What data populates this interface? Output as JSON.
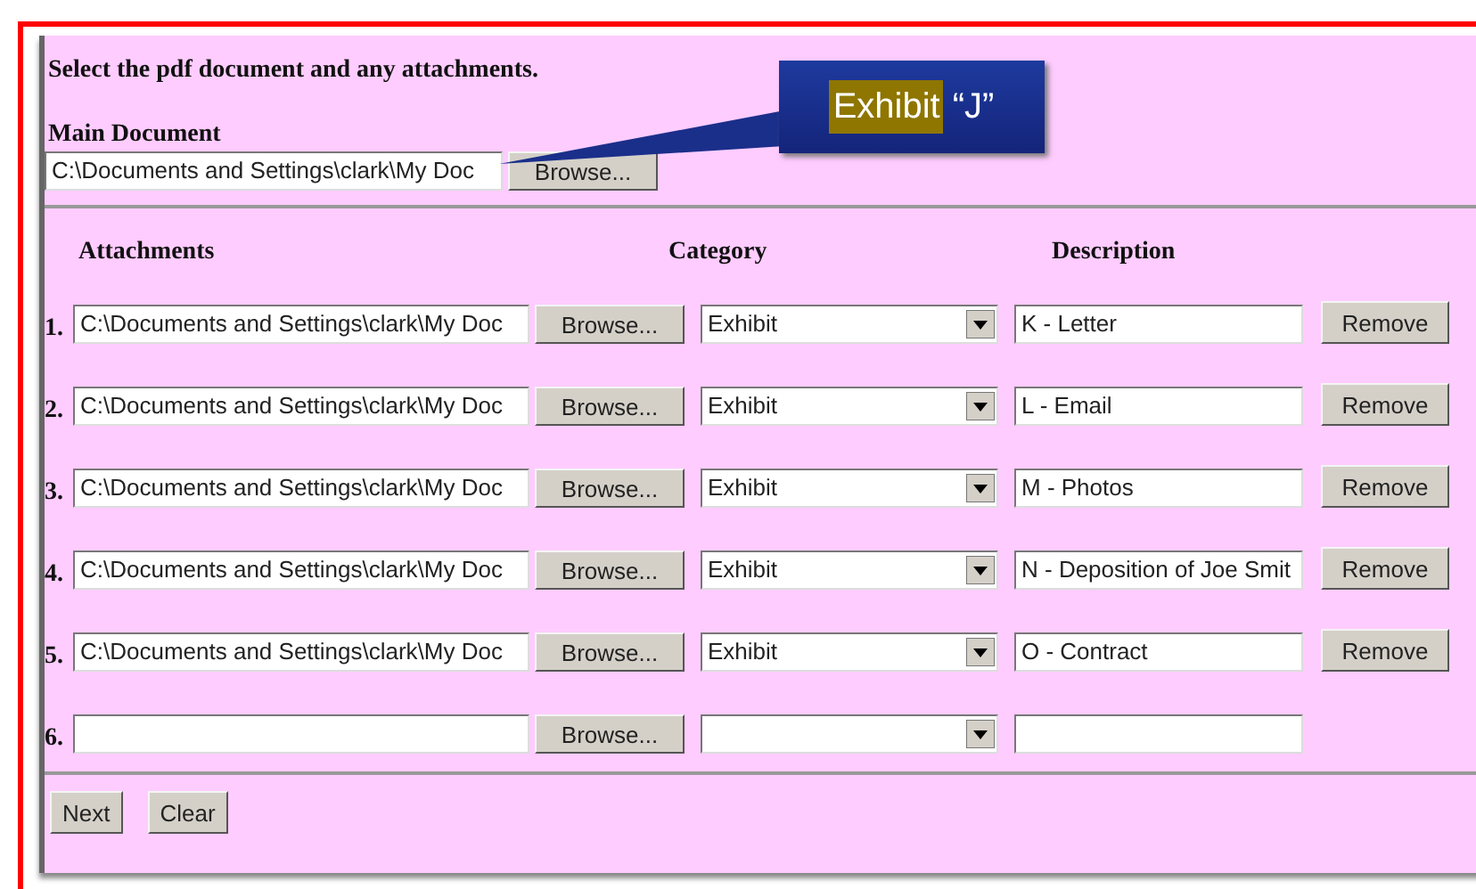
{
  "instruction": "Select the pdf document and any attachments.",
  "main_document": {
    "label": "Main Document",
    "value": "C:\\Documents and Settings\\clark\\My Doc",
    "browse": "Browse..."
  },
  "callout": {
    "highlight": "Exhibit",
    "text": "“J”"
  },
  "columns": [
    "Attachments",
    "Category",
    "Description"
  ],
  "rows": [
    {
      "number": "1.",
      "file": "C:\\Documents and Settings\\clark\\My Doc",
      "browse": "Browse...",
      "category": "Exhibit",
      "description": "K - Letter",
      "remove": "Remove"
    },
    {
      "number": "2.",
      "file": "C:\\Documents and Settings\\clark\\My Doc",
      "browse": "Browse...",
      "category": "Exhibit",
      "description": "L - Email",
      "remove": "Remove"
    },
    {
      "number": "3.",
      "file": "C:\\Documents and Settings\\clark\\My Doc",
      "browse": "Browse...",
      "category": "Exhibit",
      "description": "M - Photos",
      "remove": "Remove"
    },
    {
      "number": "4.",
      "file": "C:\\Documents and Settings\\clark\\My Doc",
      "browse": "Browse...",
      "category": "Exhibit",
      "description": "N - Deposition of Joe Smit",
      "remove": "Remove"
    },
    {
      "number": "5.",
      "file": "C:\\Documents and Settings\\clark\\My Doc",
      "browse": "Browse...",
      "category": "Exhibit",
      "description": "O - Contract",
      "remove": "Remove"
    },
    {
      "number": "6.",
      "browse": "Browse..."
    }
  ],
  "buttons": [
    "Next",
    "Clear"
  ]
}
